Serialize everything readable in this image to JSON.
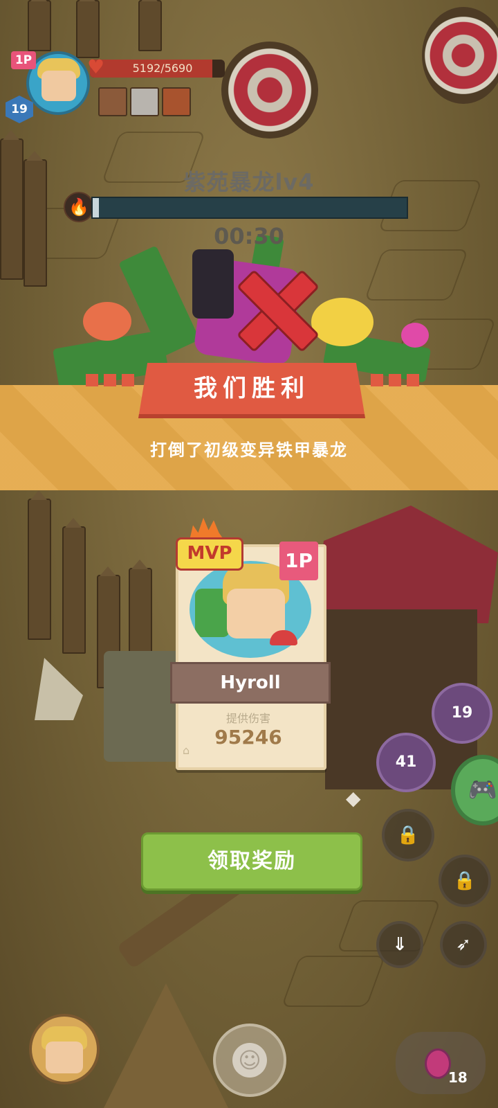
{
  "hud": {
    "player_badge": "1P",
    "player_level": "19",
    "hp_text": "5192/5690",
    "hp_fraction": 0.91
  },
  "boss": {
    "name": "紫苑暴龙lv4",
    "timer": "00:30",
    "health_fraction": 0.02
  },
  "victory": {
    "title": "我们胜利",
    "subtitle": "打倒了初级变异铁甲暴龙"
  },
  "mvp_card": {
    "mvp_label": "MVP",
    "player_badge": "1P",
    "player_name": "Hyroll",
    "damage_label": "提供伤害",
    "damage_value": "95246"
  },
  "claim_button": {
    "label": "领取奖励"
  },
  "controls": {
    "skill_1_cooldown": "19",
    "skill_2_cooldown": "41",
    "potion_count": "18"
  },
  "icons": {
    "hp": "heart-icon",
    "boss": "fire-icon",
    "lock": "lock-icon",
    "gamepad": "gamepad-icon",
    "emoji": "smiley-icon",
    "potion": "potion-icon"
  },
  "colors": {
    "victory_band": "#e5a94a",
    "ribbon": "#e05a42",
    "claim_button": "#8dc04a",
    "mvp_badge": "#f5d74a"
  }
}
